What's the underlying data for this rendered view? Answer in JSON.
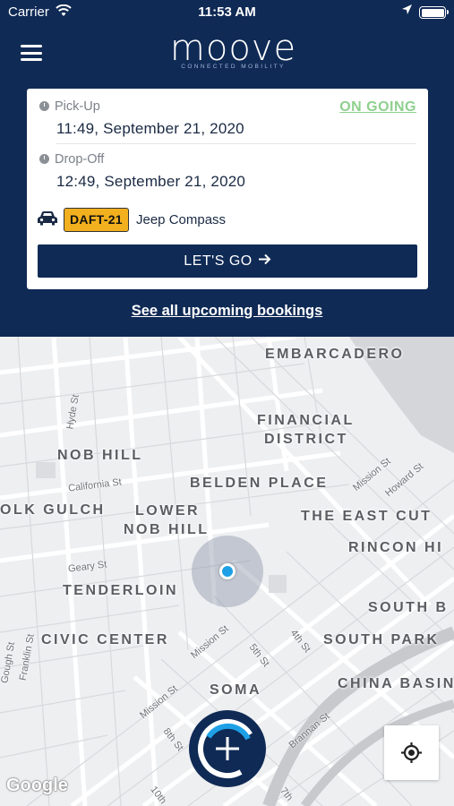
{
  "status_bar": {
    "carrier": "Carrier",
    "time": "11:53 AM",
    "battery_level": 1.0
  },
  "header": {
    "logo_text": "moove",
    "logo_tagline": "CONNECTED MOBILITY",
    "menu_icon": "hamburger-icon",
    "background": "#0f2a55"
  },
  "booking": {
    "pickup_label": "Pick-Up",
    "pickup_value": "11:49, September 21, 2020",
    "status": "ON GOING",
    "status_color": "#8fd08f",
    "dropoff_label": "Drop-Off",
    "dropoff_value": "12:49, September 21, 2020",
    "plate": "DAFT-21",
    "plate_color": "#f2b01e",
    "car_model": "Jeep Compass",
    "go_label": "LET'S GO",
    "go_icon": "arrow-right-icon"
  },
  "see_all_label": "See all upcoming bookings",
  "map": {
    "areas": [
      "EMBARCADERO",
      "FINANCIAL",
      "DISTRICT",
      "NOB HILL",
      "BELDEN PLACE",
      "OLK GULCH",
      "LOWER",
      "NOB HILL",
      "THE EAST CUT",
      "RINCON HI",
      "TENDERLOIN",
      "SOUTH B",
      "CIVIC CENTER",
      "SOUTH PARK",
      "SOMA",
      "CHINA BASIN"
    ],
    "streets": [
      "Hyde St",
      "California St",
      "Mission St",
      "Howard St",
      "Geary St",
      "Mission St",
      "Franklin St",
      "Gough St",
      "Mission St",
      "5th St",
      "4th St",
      "8th St",
      "Brannan St",
      "10th",
      "7th"
    ],
    "attribution": "Google",
    "locate_icon": "crosshair-icon",
    "fab_icon": "plus-icon"
  }
}
